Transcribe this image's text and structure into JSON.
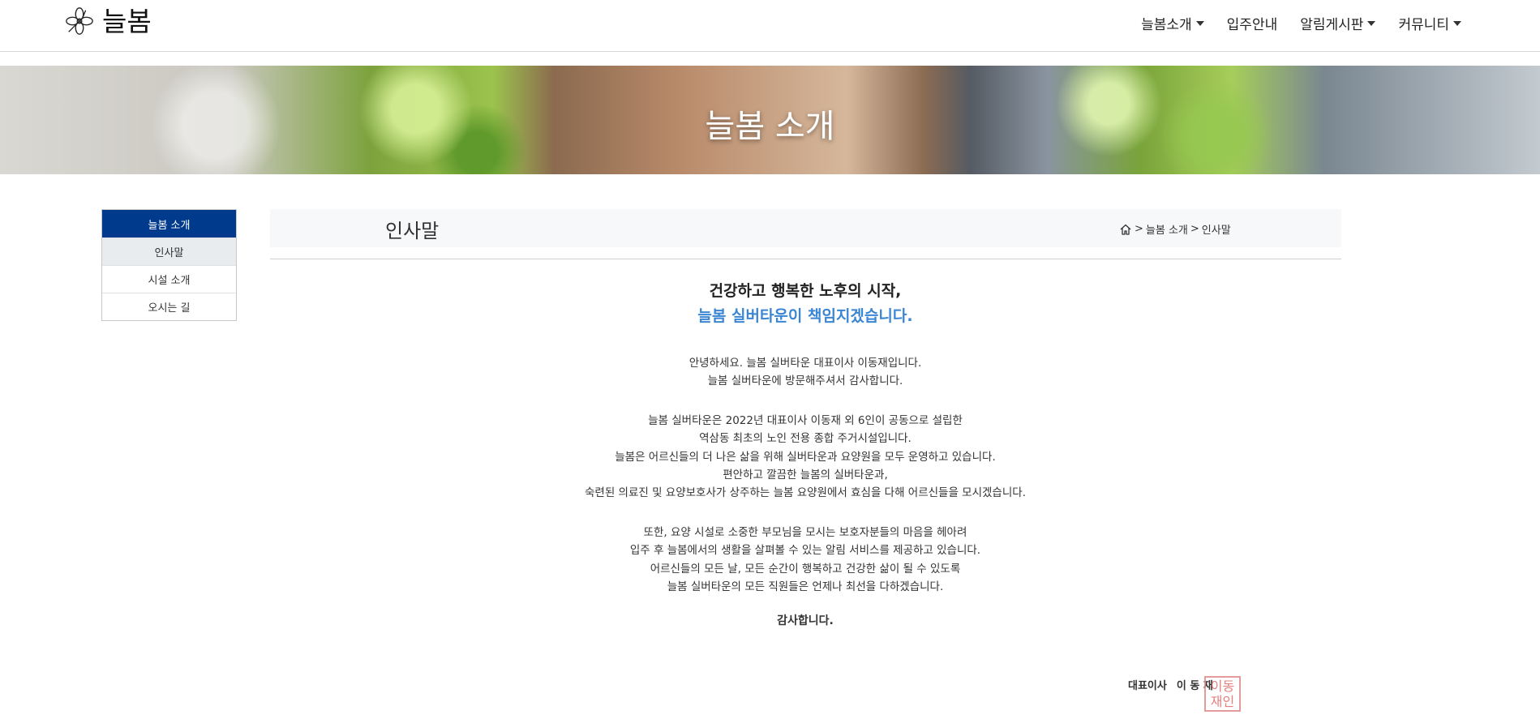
{
  "brand": {
    "name": "늘봄",
    "logo_icon": "flower-icon"
  },
  "nav": {
    "items": [
      {
        "label": "늘봄소개",
        "has_dropdown": true
      },
      {
        "label": "입주안내",
        "has_dropdown": false
      },
      {
        "label": "알림게시판",
        "has_dropdown": true
      },
      {
        "label": "커뮤니티",
        "has_dropdown": true
      }
    ]
  },
  "hero": {
    "title": "늘봄 소개"
  },
  "sidebar": {
    "heading": "늘봄 소개",
    "items": [
      {
        "label": "인사말",
        "active": true
      },
      {
        "label": "시설 소개",
        "active": false
      },
      {
        "label": "오시는 길",
        "active": false
      }
    ]
  },
  "content": {
    "title": "인사말",
    "breadcrumb": {
      "home_icon": "home-icon",
      "items": [
        "늘봄 소개",
        "인사말"
      ],
      "separator": ">"
    }
  },
  "greeting": {
    "headline_line1": "건강하고 행복한 노후의 시작,",
    "headline_line2": "늘봄 실버타운이 책임지겠습니다.",
    "paragraphs": [
      [
        "안녕하세요. 늘봄 실버타운 대표이사 이동재입니다.",
        "늘봄 실버타운에 방문해주셔서 감사합니다."
      ],
      [
        "늘봄 실버타운은 2022년 대표이사 이동재 외 6인이 공동으로 설립한",
        "역삼동 최초의 노인 전용 종합 주거시설입니다.",
        "늘봄은 어르신들의 더 나은 삶을 위해 실버타운과 요양원을 모두 운영하고 있습니다.",
        "편안하고 깔끔한 늘봄의 실버타운과,",
        "숙련된 의료진 및 요양보호사가 상주하는 늘봄 요양원에서 효심을 다해 어르신들을 모시겠습니다."
      ],
      [
        "또한, 요양 시설로 소중한 부모님을 모시는 보호자분들의 마음을 헤아려",
        "입주 후 늘봄에서의 생활을 살펴볼 수 있는 알림 서비스를 제공하고 있습니다.",
        "어르신들의 모든 날, 모든 순간이 행복하고 건강한 삶이 될 수 있도록",
        "늘봄 실버타운의 모든 직원들은 언제나 최선을 다하겠습니다."
      ]
    ],
    "closing": "감사합니다."
  },
  "signature": {
    "title": "대표이사",
    "name": "이 동 재",
    "seal_text": "이동재인"
  },
  "colors": {
    "primary_navy": "#003a8c",
    "accent_blue": "#3b86d4",
    "seal_red": "#e06a6a"
  }
}
